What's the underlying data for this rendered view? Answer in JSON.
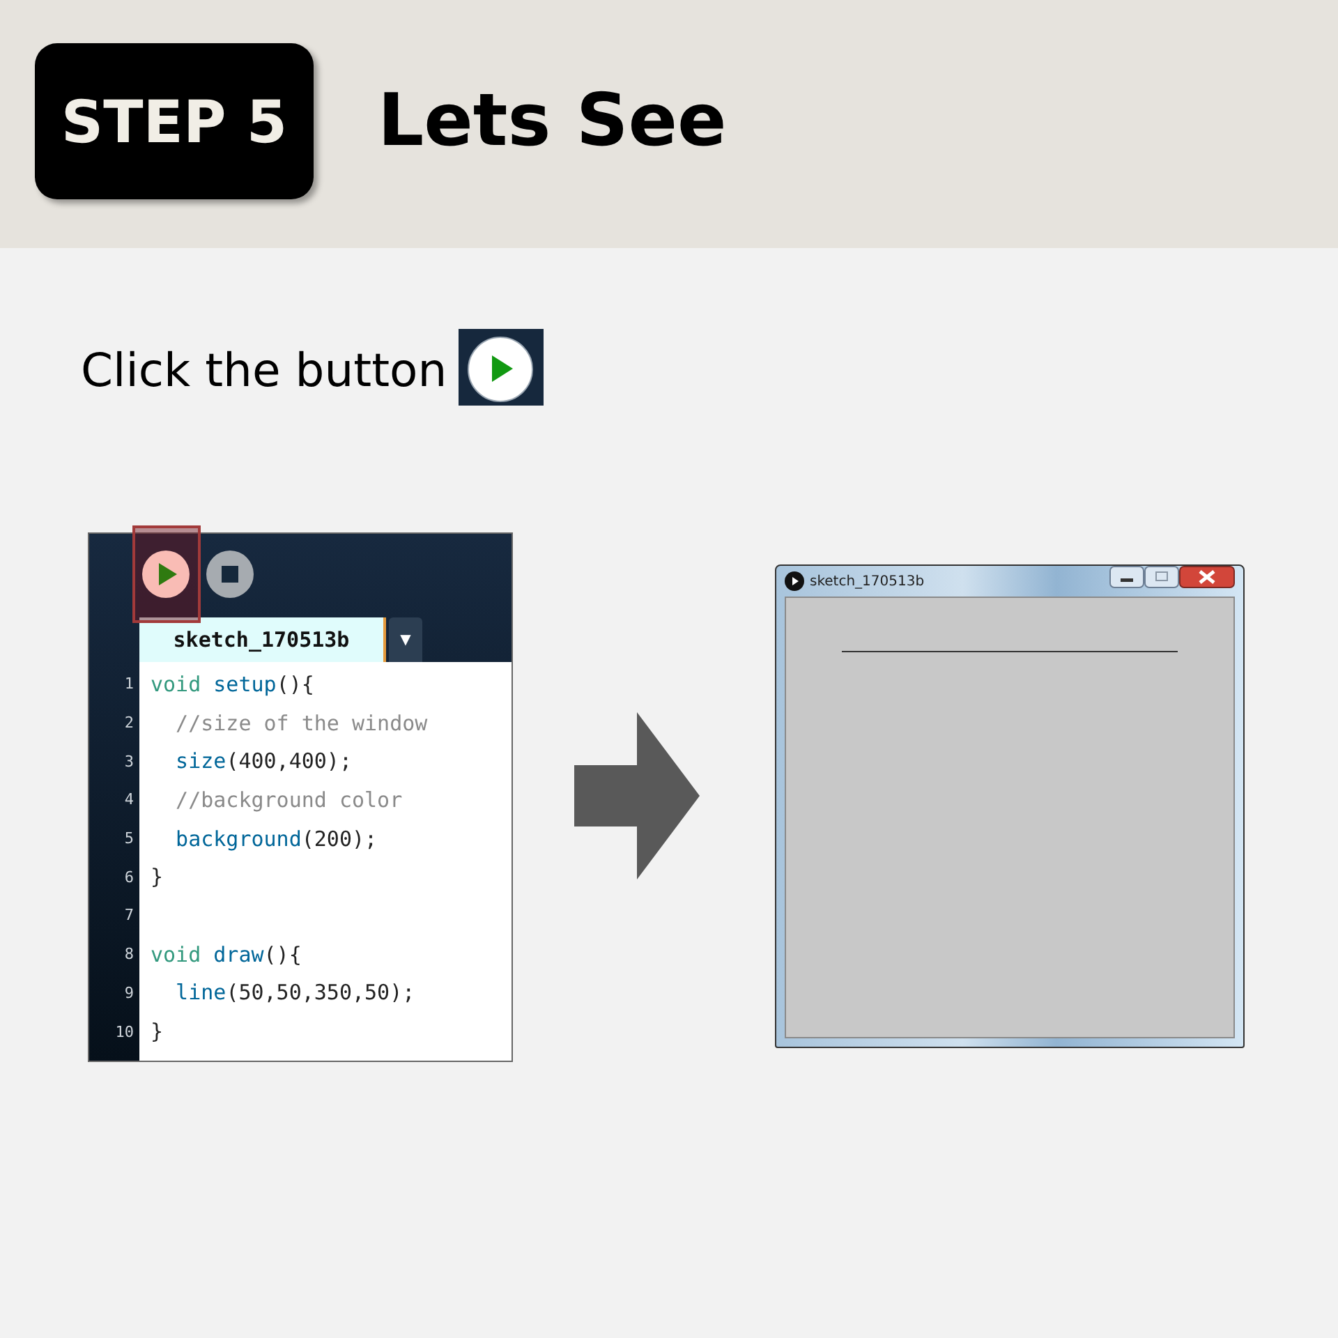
{
  "header": {
    "badge": "STEP 5",
    "title": "Lets See"
  },
  "instruction": {
    "text": "Click the button"
  },
  "editor": {
    "run_highlighted": true,
    "tab": "sketch_170513b",
    "tab_menu": "▼",
    "lines": [
      {
        "number": "1",
        "tokens": [
          {
            "kind": "keyword",
            "text": "void "
          },
          {
            "kind": "function",
            "text": "setup"
          },
          {
            "kind": "plain",
            "text": "(){"
          }
        ]
      },
      {
        "number": "2",
        "tokens": [
          {
            "kind": "comment",
            "text": "  //size of the window"
          }
        ]
      },
      {
        "number": "3",
        "tokens": [
          {
            "kind": "function",
            "text": "  size"
          },
          {
            "kind": "plain",
            "text": "(400,400);"
          }
        ]
      },
      {
        "number": "4",
        "tokens": [
          {
            "kind": "comment",
            "text": "  //background color"
          }
        ]
      },
      {
        "number": "5",
        "tokens": [
          {
            "kind": "function",
            "text": "  background"
          },
          {
            "kind": "plain",
            "text": "(200);"
          }
        ]
      },
      {
        "number": "6",
        "tokens": [
          {
            "kind": "plain",
            "text": "}"
          }
        ]
      },
      {
        "number": "7"
      },
      {
        "number": "8",
        "tokens": [
          {
            "kind": "keyword",
            "text": "void "
          },
          {
            "kind": "function",
            "text": "draw"
          },
          {
            "kind": "plain",
            "text": "(){"
          }
        ]
      },
      {
        "number": "9",
        "tokens": [
          {
            "kind": "function",
            "text": "  line"
          },
          {
            "kind": "plain",
            "text": "(50,50,350,50);"
          }
        ]
      },
      {
        "number": "10",
        "tokens": [
          {
            "kind": "plain",
            "text": "}"
          }
        ]
      }
    ]
  },
  "sketch_window": {
    "title": "sketch_170513b"
  }
}
